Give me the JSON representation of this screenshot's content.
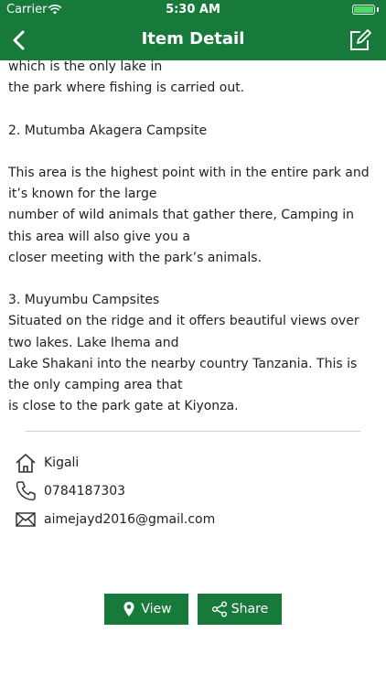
{
  "status": {
    "carrier": "Carrier",
    "time": "5:30 AM"
  },
  "nav": {
    "title": "Item Detail"
  },
  "content": {
    "lines": [
      "which is the only lake in",
      "the park where fishing is carried out.",
      "",
      "2. Mutumba Akagera Campsite",
      "",
      "This area is the highest point with in the entire park and it’s known for the large",
      "number of wild animals that gather there, Camping in this area will also give you a",
      "closer meeting with the park’s animals.",
      "",
      "3. Muyumbu Campsites",
      "Situated on the ridge and it offers beautiful views over two lakes. Lake Ihema and",
      "Lake Shakani into the nearby country Tanzania. This is the only camping area that",
      "is close to the park gate at Kiyonza."
    ]
  },
  "info": {
    "location": "Kigali",
    "phone": "0784187303",
    "email": "aimejayd2016@gmail.com"
  },
  "actions": {
    "view_label": "View",
    "share_label": "Share"
  },
  "colors": {
    "brand": "#177a3b",
    "battery": "#4cd964"
  },
  "icons": [
    "back-chevron-icon",
    "edit-icon",
    "home-icon",
    "phone-icon",
    "mail-icon",
    "location-pin-icon",
    "share-icon",
    "wifi-icon",
    "battery-icon"
  ]
}
